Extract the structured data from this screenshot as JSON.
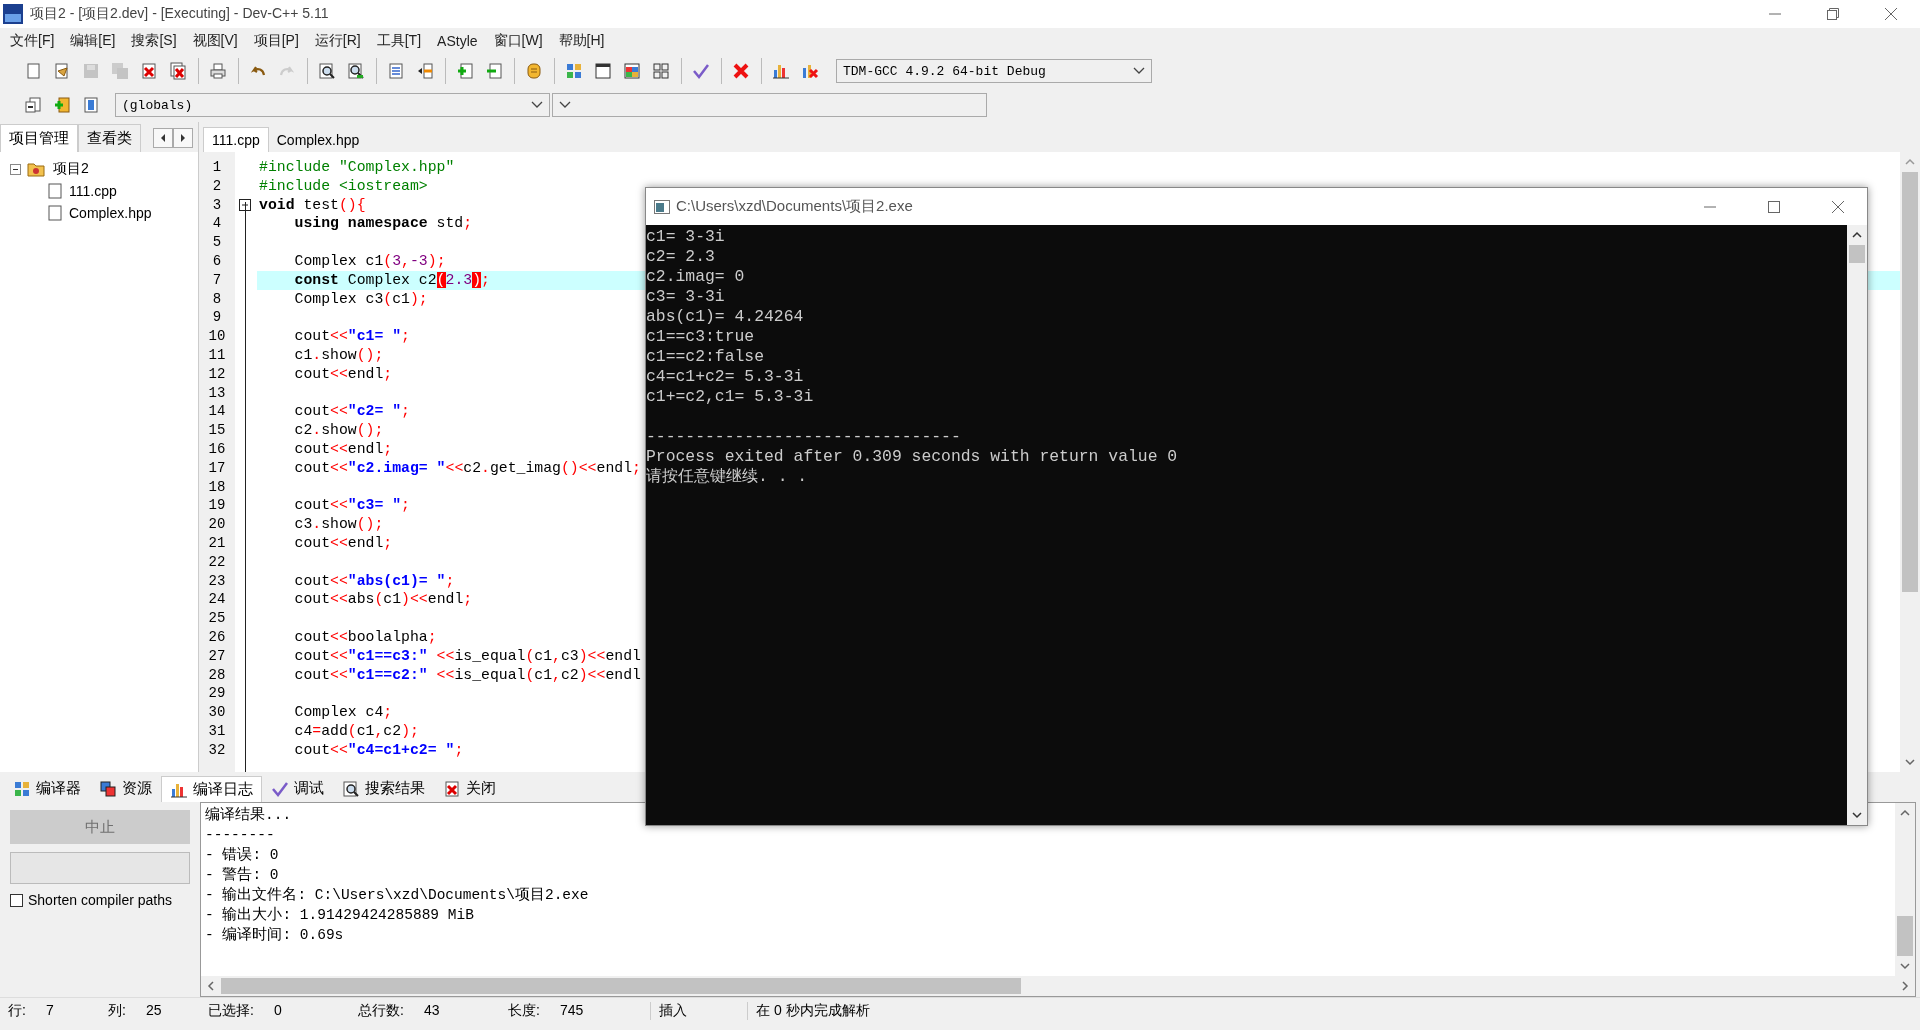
{
  "window": {
    "title": "项目2 - [项目2.dev] - [Executing] - Dev-C++ 5.11"
  },
  "menu": [
    "文件[F]",
    "编辑[E]",
    "搜索[S]",
    "视图[V]",
    "项目[P]",
    "运行[R]",
    "工具[T]",
    "AStyle",
    "窗口[W]",
    "帮助[H]"
  ],
  "toolbar": [
    [
      {
        "kind": "new",
        "disabled": false
      },
      {
        "kind": "open",
        "disabled": false
      },
      {
        "kind": "save",
        "disabled": true
      },
      {
        "kind": "saveall",
        "disabled": true
      },
      {
        "kind": "close",
        "disabled": false
      },
      {
        "kind": "closeall",
        "disabled": false
      }
    ],
    [
      {
        "kind": "print",
        "disabled": false
      }
    ],
    [
      {
        "kind": "undo",
        "disabled": false
      },
      {
        "kind": "redo",
        "disabled": true
      }
    ],
    [
      {
        "kind": "find",
        "disabled": false
      },
      {
        "kind": "replace",
        "disabled": false
      }
    ],
    [
      {
        "kind": "indent",
        "disabled": false
      },
      {
        "kind": "unindent",
        "disabled": false
      }
    ],
    [
      {
        "kind": "addfile",
        "disabled": false
      },
      {
        "kind": "removefile",
        "disabled": false
      }
    ],
    [
      {
        "kind": "bookmark",
        "disabled": false
      }
    ],
    [
      {
        "kind": "compile",
        "disabled": false
      },
      {
        "kind": "run",
        "disabled": false
      },
      {
        "kind": "compilerun",
        "disabled": false
      },
      {
        "kind": "rebuild",
        "disabled": false
      }
    ],
    [
      {
        "kind": "check",
        "disabled": false
      }
    ],
    [
      {
        "kind": "stop",
        "disabled": false
      }
    ],
    [
      {
        "kind": "chart",
        "disabled": false
      },
      {
        "kind": "profiledelete",
        "disabled": false
      }
    ]
  ],
  "compiler_select": {
    "value": "TDM-GCC 4.9.2 64-bit Debug"
  },
  "toolbar2": [
    {
      "kind": "gotoclass",
      "disabled": false
    },
    {
      "kind": "insert",
      "disabled": false
    },
    {
      "kind": "toggle",
      "disabled": false
    }
  ],
  "scope_select": {
    "value": "(globals)"
  },
  "left_tabs": [
    {
      "label": "项目管理",
      "selected": true
    },
    {
      "label": "查看类",
      "selected": false
    }
  ],
  "project_tree": [
    {
      "label": "项目2",
      "kind": "project",
      "expanded": true,
      "children": [
        {
          "label": "111.cpp",
          "kind": "file"
        },
        {
          "label": "Complex.hpp",
          "kind": "file"
        }
      ]
    }
  ],
  "editor_tabs": [
    {
      "label": "111.cpp",
      "selected": true
    },
    {
      "label": "Complex.hpp",
      "selected": false
    }
  ],
  "code_lines": [
    {
      "number": "1",
      "current": false,
      "indented": false,
      "segments": [
        {
          "kind": "pre",
          "text": "#include \"Complex.hpp\""
        }
      ]
    },
    {
      "number": "2",
      "current": false,
      "indented": false,
      "segments": [
        {
          "kind": "pre",
          "text": "#include <iostream>"
        }
      ]
    },
    {
      "number": "3",
      "current": false,
      "indented": false,
      "collapsed": false,
      "segments": [
        {
          "kind": "kw",
          "text": "void"
        },
        {
          "kind": "plain",
          "text": " test"
        },
        {
          "kind": "sym",
          "text": "(){"
        }
      ]
    },
    {
      "number": "4",
      "current": false,
      "indented": true,
      "segments": [
        {
          "kind": "kw",
          "text": "using namespace"
        },
        {
          "kind": "plain",
          "text": " std"
        },
        {
          "kind": "sym",
          "text": ";"
        }
      ]
    },
    {
      "number": "5",
      "current": false
    },
    {
      "number": "6",
      "current": false,
      "indented": true,
      "segments": [
        {
          "kind": "plain",
          "text": "Complex c1"
        },
        {
          "kind": "sym",
          "text": "("
        },
        {
          "kind": "num",
          "text": "3"
        },
        {
          "kind": "sym",
          "text": ","
        },
        {
          "kind": "num",
          "text": "-3"
        },
        {
          "kind": "sym",
          "text": ");"
        }
      ]
    },
    {
      "number": "7",
      "current": true,
      "indented": true,
      "segments": [
        {
          "kind": "kw",
          "text": "const"
        },
        {
          "kind": "plain",
          "text": " Complex c2"
        },
        {
          "kind": "match",
          "text": "("
        },
        {
          "kind": "num",
          "text": "2.3"
        },
        {
          "kind": "match",
          "text": ")"
        },
        {
          "kind": "sym",
          "text": ";"
        }
      ]
    },
    {
      "number": "8",
      "current": false,
      "indented": true,
      "segments": [
        {
          "kind": "plain",
          "text": "Complex c3"
        },
        {
          "kind": "sym",
          "text": "("
        },
        {
          "kind": "plain",
          "text": "c1"
        },
        {
          "kind": "sym",
          "text": ");"
        }
      ]
    },
    {
      "number": "9",
      "current": false
    },
    {
      "number": "10",
      "current": false,
      "indented": true,
      "segments": [
        {
          "kind": "plain",
          "text": "cout"
        },
        {
          "kind": "sym",
          "text": "<<"
        },
        {
          "kind": "str",
          "text": "\"c1= \""
        },
        {
          "kind": "sym",
          "text": ";"
        }
      ]
    },
    {
      "number": "11",
      "current": false,
      "indented": true,
      "segments": [
        {
          "kind": "plain",
          "text": "c1"
        },
        {
          "kind": "sym",
          "text": "."
        },
        {
          "kind": "plain",
          "text": "show"
        },
        {
          "kind": "sym",
          "text": "();"
        }
      ]
    },
    {
      "number": "12",
      "current": false,
      "indented": true,
      "segments": [
        {
          "kind": "plain",
          "text": "cout"
        },
        {
          "kind": "sym",
          "text": "<<"
        },
        {
          "kind": "plain",
          "text": "endl"
        },
        {
          "kind": "sym",
          "text": ";"
        }
      ]
    },
    {
      "number": "13",
      "current": false
    },
    {
      "number": "14",
      "current": false,
      "indented": true,
      "segments": [
        {
          "kind": "plain",
          "text": "cout"
        },
        {
          "kind": "sym",
          "text": "<<"
        },
        {
          "kind": "str",
          "text": "\"c2= \""
        },
        {
          "kind": "sym",
          "text": ";"
        }
      ]
    },
    {
      "number": "15",
      "current": false,
      "indented": true,
      "segments": [
        {
          "kind": "plain",
          "text": "c2"
        },
        {
          "kind": "sym",
          "text": "."
        },
        {
          "kind": "plain",
          "text": "show"
        },
        {
          "kind": "sym",
          "text": "();"
        }
      ]
    },
    {
      "number": "16",
      "current": false,
      "indented": true,
      "segments": [
        {
          "kind": "plain",
          "text": "cout"
        },
        {
          "kind": "sym",
          "text": "<<"
        },
        {
          "kind": "plain",
          "text": "endl"
        },
        {
          "kind": "sym",
          "text": ";"
        }
      ]
    },
    {
      "number": "17",
      "current": false,
      "indented": true,
      "segments": [
        {
          "kind": "plain",
          "text": "cout"
        },
        {
          "kind": "sym",
          "text": "<<"
        },
        {
          "kind": "str",
          "text": "\"c2.imag= \""
        },
        {
          "kind": "sym",
          "text": "<<"
        },
        {
          "kind": "plain",
          "text": "c2"
        },
        {
          "kind": "sym",
          "text": "."
        },
        {
          "kind": "plain",
          "text": "get_imag"
        },
        {
          "kind": "sym",
          "text": "()<<"
        },
        {
          "kind": "plain",
          "text": "endl"
        },
        {
          "kind": "sym",
          "text": ";"
        }
      ]
    },
    {
      "number": "18",
      "current": false
    },
    {
      "number": "19",
      "current": false,
      "indented": true,
      "segments": [
        {
          "kind": "plain",
          "text": "cout"
        },
        {
          "kind": "sym",
          "text": "<<"
        },
        {
          "kind": "str",
          "text": "\"c3= \""
        },
        {
          "kind": "sym",
          "text": ";"
        }
      ]
    },
    {
      "number": "20",
      "current": false,
      "indented": true,
      "segments": [
        {
          "kind": "plain",
          "text": "c3"
        },
        {
          "kind": "sym",
          "text": "."
        },
        {
          "kind": "plain",
          "text": "show"
        },
        {
          "kind": "sym",
          "text": "();"
        }
      ]
    },
    {
      "number": "21",
      "current": false,
      "indented": true,
      "segments": [
        {
          "kind": "plain",
          "text": "cout"
        },
        {
          "kind": "sym",
          "text": "<<"
        },
        {
          "kind": "plain",
          "text": "endl"
        },
        {
          "kind": "sym",
          "text": ";"
        }
      ]
    },
    {
      "number": "22",
      "current": false
    },
    {
      "number": "23",
      "current": false,
      "indented": true,
      "segments": [
        {
          "kind": "plain",
          "text": "cout"
        },
        {
          "kind": "sym",
          "text": "<<"
        },
        {
          "kind": "str",
          "text": "\"abs(c1)= \""
        },
        {
          "kind": "sym",
          "text": ";"
        }
      ]
    },
    {
      "number": "24",
      "current": false,
      "indented": true,
      "segments": [
        {
          "kind": "plain",
          "text": "cout"
        },
        {
          "kind": "sym",
          "text": "<<"
        },
        {
          "kind": "plain",
          "text": "abs"
        },
        {
          "kind": "sym",
          "text": "("
        },
        {
          "kind": "plain",
          "text": "c1"
        },
        {
          "kind": "sym",
          "text": ")<<"
        },
        {
          "kind": "plain",
          "text": "endl"
        },
        {
          "kind": "sym",
          "text": ";"
        }
      ]
    },
    {
      "number": "25",
      "current": false
    },
    {
      "number": "26",
      "current": false,
      "indented": true,
      "segments": [
        {
          "kind": "plain",
          "text": "cout"
        },
        {
          "kind": "sym",
          "text": "<<"
        },
        {
          "kind": "plain",
          "text": "boolalpha"
        },
        {
          "kind": "sym",
          "text": ";"
        }
      ]
    },
    {
      "number": "27",
      "current": false,
      "indented": true,
      "segments": [
        {
          "kind": "plain",
          "text": "cout"
        },
        {
          "kind": "sym",
          "text": "<<"
        },
        {
          "kind": "str",
          "text": "\"c1==c3:\""
        },
        {
          "kind": "sym",
          "text": " <<"
        },
        {
          "kind": "plain",
          "text": "is_equal"
        },
        {
          "kind": "sym",
          "text": "("
        },
        {
          "kind": "plain",
          "text": "c1"
        },
        {
          "kind": "sym",
          "text": ","
        },
        {
          "kind": "plain",
          "text": "c3"
        },
        {
          "kind": "sym",
          "text": ")<<"
        },
        {
          "kind": "plain",
          "text": "endl"
        }
      ]
    },
    {
      "number": "28",
      "current": false,
      "indented": true,
      "segments": [
        {
          "kind": "plain",
          "text": "cout"
        },
        {
          "kind": "sym",
          "text": "<<"
        },
        {
          "kind": "str",
          "text": "\"c1==c2:\""
        },
        {
          "kind": "sym",
          "text": " <<"
        },
        {
          "kind": "plain",
          "text": "is_equal"
        },
        {
          "kind": "sym",
          "text": "("
        },
        {
          "kind": "plain",
          "text": "c1"
        },
        {
          "kind": "sym",
          "text": ","
        },
        {
          "kind": "plain",
          "text": "c2"
        },
        {
          "kind": "sym",
          "text": ")<<"
        },
        {
          "kind": "plain",
          "text": "endl"
        }
      ]
    },
    {
      "number": "29",
      "current": false
    },
    {
      "number": "30",
      "current": false,
      "indented": true,
      "segments": [
        {
          "kind": "plain",
          "text": "Complex c4"
        },
        {
          "kind": "sym",
          "text": ";"
        }
      ]
    },
    {
      "number": "31",
      "current": false,
      "indented": true,
      "segments": [
        {
          "kind": "plain",
          "text": "c4"
        },
        {
          "kind": "sym",
          "text": "="
        },
        {
          "kind": "plain",
          "text": "add"
        },
        {
          "kind": "sym",
          "text": "("
        },
        {
          "kind": "plain",
          "text": "c1"
        },
        {
          "kind": "sym",
          "text": ","
        },
        {
          "kind": "plain",
          "text": "c2"
        },
        {
          "kind": "sym",
          "text": ");"
        }
      ]
    },
    {
      "number": "32",
      "current": false,
      "indented": true,
      "segments": [
        {
          "kind": "plain",
          "text": "cout"
        },
        {
          "kind": "sym",
          "text": "<<"
        },
        {
          "kind": "str",
          "text": "\"c4=c1+c2= \""
        },
        {
          "kind": "sym",
          "text": ";"
        }
      ]
    }
  ],
  "console": {
    "title": "C:\\Users\\xzd\\Documents\\项目2.exe",
    "blocks": [
      [
        "c1= 3-3i",
        "c2= 2.3",
        "c2.imag= 0",
        "c3= 3-3i",
        "abs(c1)= 4.24264",
        "c1==c3:true",
        "c1==c2:false",
        "c4=c1+c2= 5.3-3i",
        "c1+=c2,c1= 5.3-3i"
      ],
      [
        "--------------------------------",
        "Process exited after 0.309 seconds with return value 0",
        "请按任意键继续. . ."
      ]
    ]
  },
  "bottom_tabs": [
    {
      "label": "编译器",
      "kind": "compiler",
      "selected": false
    },
    {
      "label": "资源",
      "kind": "resources",
      "selected": false
    },
    {
      "label": "编译日志",
      "kind": "log",
      "selected": true
    },
    {
      "label": "调试",
      "kind": "debug",
      "selected": false
    },
    {
      "label": "搜索结果",
      "kind": "search",
      "selected": false
    },
    {
      "label": "关闭",
      "kind": "close",
      "selected": false
    }
  ],
  "abort_button": {
    "label": "中止",
    "disabled": true
  },
  "progress": {
    "level": 0
  },
  "shorten_paths": {
    "label": "Shorten compiler paths",
    "checked": false
  },
  "compile_log": [
    "编译结果...",
    "--------",
    "- 错误: 0",
    "- 警告: 0",
    "- 输出文件名: C:\\Users\\xzd\\Documents\\项目2.exe",
    "- 输出大小: 1.91429424285889 MiB",
    "- 编译时间: 0.69s"
  ],
  "status_bar": [
    {
      "kind": "pair",
      "label": "行:",
      "value": "7"
    },
    {
      "kind": "pair",
      "label": "列:",
      "value": "25"
    },
    {
      "kind": "pair",
      "label": "已选择:",
      "value": "0"
    },
    {
      "kind": "pair",
      "label": "总行数:",
      "value": "43"
    },
    {
      "kind": "pair",
      "label": "长度:",
      "value": "745"
    },
    {
      "kind": "text",
      "text": "插入"
    },
    {
      "kind": "text",
      "text": "在 0 秒内完成解析"
    }
  ]
}
